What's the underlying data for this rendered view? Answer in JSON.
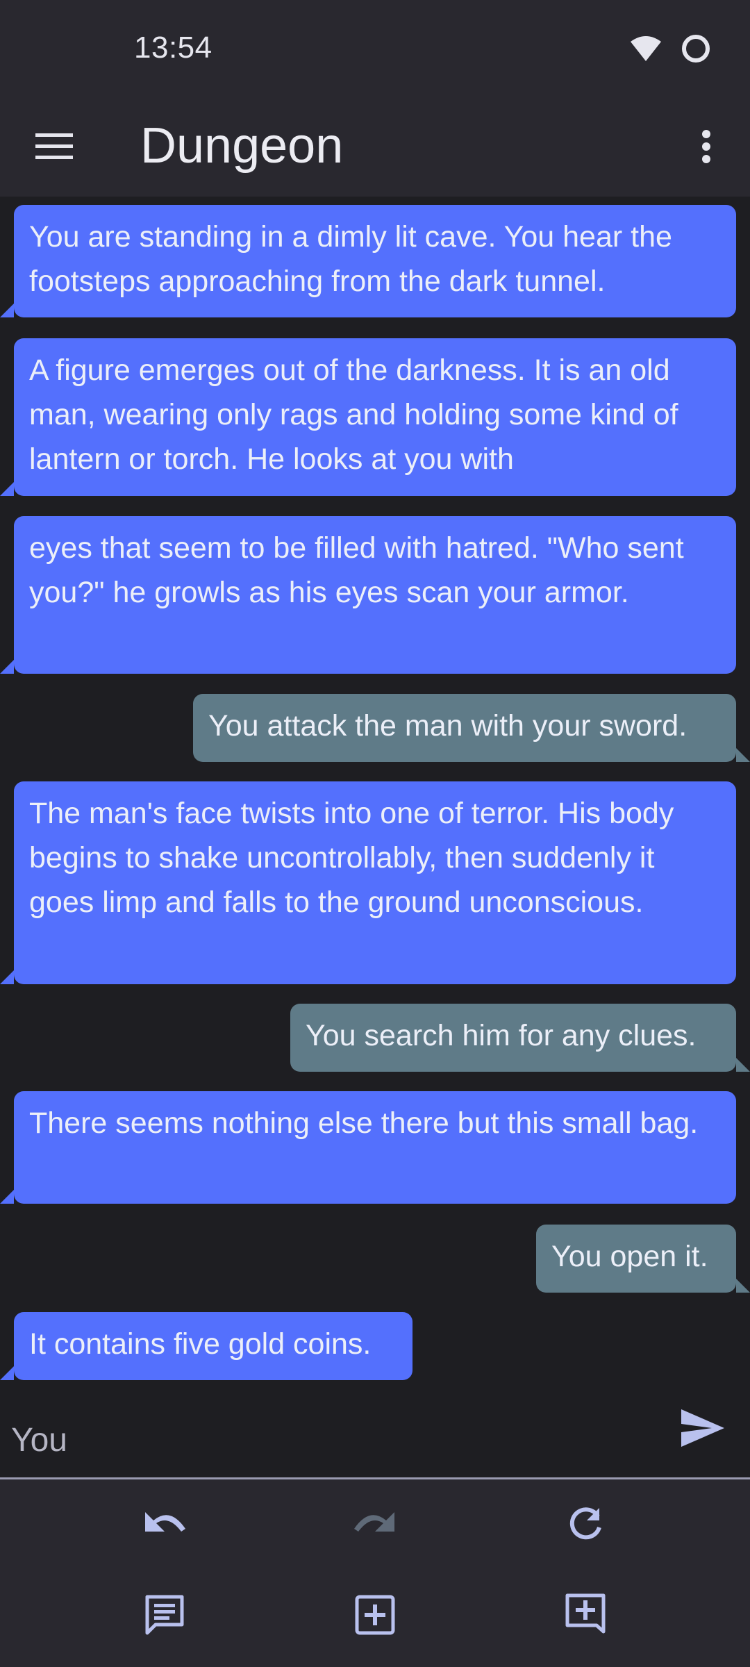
{
  "status_bar": {
    "time": "13:54"
  },
  "app_bar": {
    "title": "Dungeon"
  },
  "messages": [
    {
      "role": "ai",
      "text": "You are standing in a dimly lit cave. You hear the footsteps approaching from the dark tunnel."
    },
    {
      "role": "ai",
      "text": "A figure emerges out of the darkness. It is an old man, wearing only rags and holding some kind of lantern or torch. He looks at you with"
    },
    {
      "role": "ai",
      "text": "eyes that seem to be filled with hatred. \"Who sent you?\" he growls as his eyes scan your armor."
    },
    {
      "role": "user",
      "text": "You attack the man with your sword."
    },
    {
      "role": "ai",
      "text": "The man's face twists into one of terror. His body begins to shake uncontrollably, then suddenly it goes limp and falls to the ground unconscious."
    },
    {
      "role": "user",
      "text": "You search him for any clues."
    },
    {
      "role": "ai",
      "text": "There seems nothing else there but this small bag."
    },
    {
      "role": "user",
      "text": "You open it."
    },
    {
      "role": "ai",
      "text": "It contains five gold coins."
    }
  ],
  "input": {
    "placeholder": "You",
    "value": ""
  },
  "icons": {
    "menu": "menu-icon",
    "overflow": "more-vert-icon",
    "send": "send-icon",
    "undo": "undo-icon",
    "redo": "redo-icon",
    "refresh": "refresh-icon",
    "chat_list": "chat-list-icon",
    "add_box_1": "add-box-icon",
    "add_box_2": "add-box-icon"
  },
  "colors": {
    "ai_bubble": "#5470fd",
    "user_bubble": "#5f7b88",
    "bar_background": "#29282f",
    "chat_background": "#1e1e22",
    "icon": "#b9c1ee",
    "icon_disabled": "#5f6a78"
  }
}
